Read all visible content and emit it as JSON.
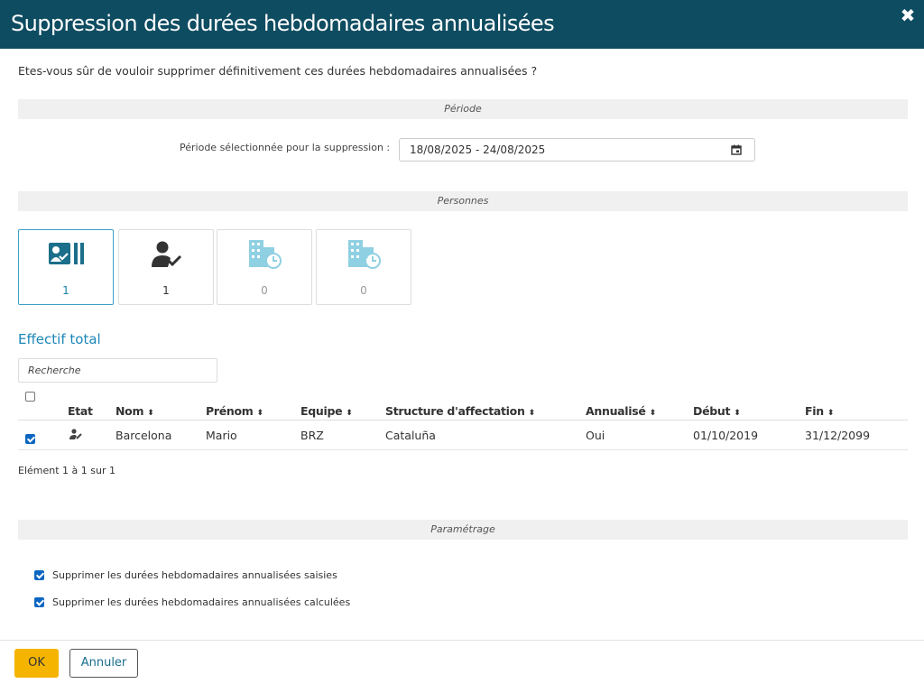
{
  "dialog": {
    "title": "Suppression des durées hebdomadaires annualisées",
    "close_icon": "close-icon",
    "question": "Etes-vous sûr de vouloir supprimer définitivement ces durées hebdomadaires annualisées ?"
  },
  "period": {
    "section_label": "Période",
    "label": "Période sélectionnée pour la suppression :",
    "value": "18/08/2025 - 24/08/2025",
    "button_icon": "calendar-icon"
  },
  "persons": {
    "section_label": "Personnes",
    "tiles": [
      {
        "icon": "id-card-selected-icon",
        "count": "1",
        "state": "active"
      },
      {
        "icon": "person-check-icon",
        "count": "1",
        "state": "normal"
      },
      {
        "icon": "building-clock-icon",
        "count": "0",
        "state": "disabled"
      },
      {
        "icon": "building-history-icon",
        "count": "0",
        "state": "disabled"
      }
    ]
  },
  "effectif": {
    "title": "Effectif total",
    "search_placeholder": "Recherche",
    "columns": [
      "Etat",
      "Nom",
      "Prénom",
      "Equipe",
      "Structure d'affectation",
      "Annualisé",
      "Début",
      "Fin"
    ],
    "sort_icon": "sort-icon",
    "rows": [
      {
        "checked": true,
        "etat_icon": "person-edit-icon",
        "nom": "Barcelona",
        "prenom": "Mario",
        "equipe": "BRZ",
        "structure": "Cataluña",
        "annualise": "Oui",
        "debut": "01/10/2019",
        "fin": "31/12/2099"
      }
    ],
    "pager": "Elément 1 à 1 sur 1"
  },
  "parametrage": {
    "section_label": "Paramétrage",
    "options": [
      {
        "label": "Supprimer les durées hebdomadaires annualisées saisies",
        "checked": true
      },
      {
        "label": "Supprimer les durées hebdomadaires annualisées calculées",
        "checked": true
      }
    ]
  },
  "footer": {
    "ok_label": "OK",
    "cancel_label": "Annuler"
  },
  "colors": {
    "header_bg": "#0e4c61",
    "accent": "#1c87b8",
    "icon_teal": "#1b6f8a",
    "icon_disabled": "#8fd0e2",
    "ok_bg": "#f5b400"
  }
}
